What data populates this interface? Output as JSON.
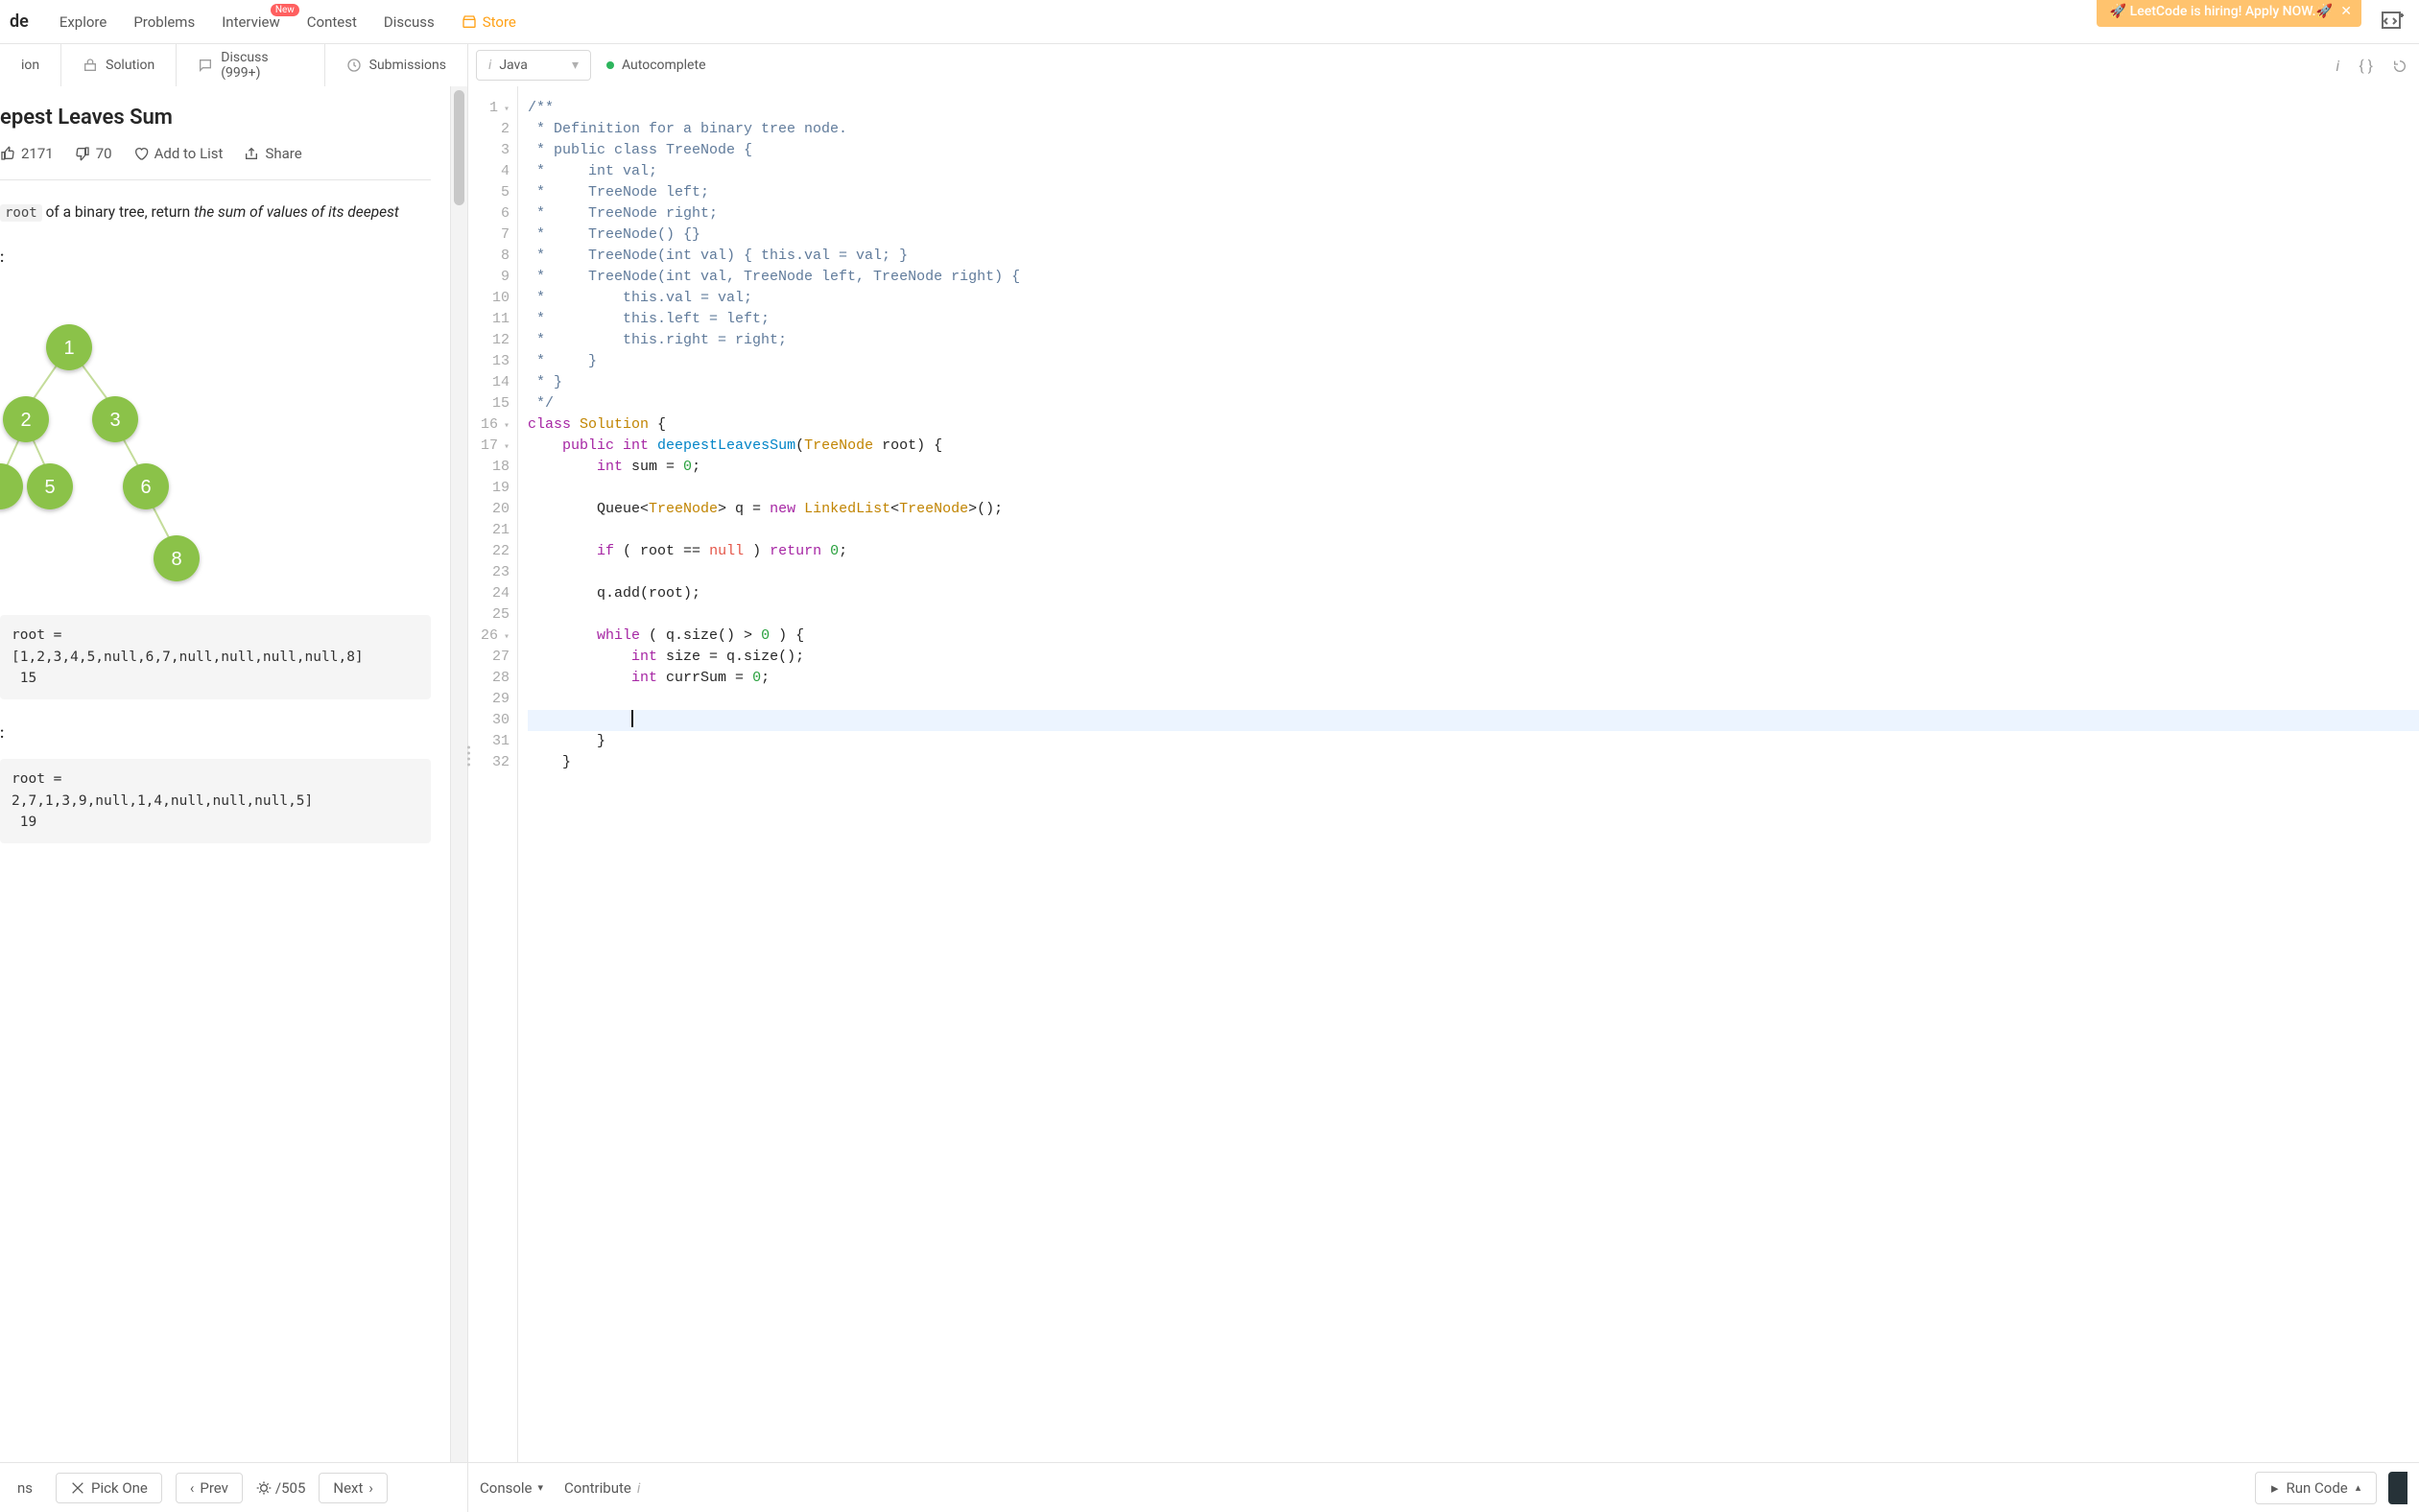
{
  "nav": {
    "brand_partial": "de",
    "links": [
      "Explore",
      "Problems",
      "Interview",
      "Contest",
      "Discuss",
      "Store"
    ],
    "interview_badge": "New",
    "hiring_text": "🚀 LeetCode is hiring! Apply NOW.🚀"
  },
  "left_tabs": {
    "description_partial": "ion",
    "solution": "Solution",
    "discuss": "Discuss (999+)",
    "submissions": "Submissions"
  },
  "editor_bar": {
    "language": "Java",
    "autocomplete": "Autocomplete"
  },
  "problem": {
    "title_partial": "epest Leaves Sum",
    "likes": "2171",
    "dislikes": "70",
    "add_to_list": "Add to List",
    "share": "Share",
    "body_prefix": "root",
    "body_mid": " of a binary tree, return ",
    "body_em": "the sum of values of its deepest",
    "example1_label": ":",
    "example1_block": "root = [1,2,3,4,5,null,6,7,null,null,null,null,8]\n 15",
    "example2_label": ":",
    "example2_block": "root =\n2,7,1,3,9,null,1,4,null,null,null,5]\n 19",
    "tree_nodes": {
      "n1": "1",
      "n2": "2",
      "n3": "3",
      "n5": "5",
      "n6": "6",
      "n8": "8"
    }
  },
  "code_lines": [
    {
      "n": 1,
      "fold": true,
      "segs": [
        {
          "t": "/**",
          "c": "comment"
        }
      ]
    },
    {
      "n": 2,
      "segs": [
        {
          "t": " * Definition for a binary tree node.",
          "c": "comment"
        }
      ]
    },
    {
      "n": 3,
      "segs": [
        {
          "t": " * public class TreeNode {",
          "c": "comment"
        }
      ]
    },
    {
      "n": 4,
      "segs": [
        {
          "t": " *     int val;",
          "c": "comment"
        }
      ]
    },
    {
      "n": 5,
      "segs": [
        {
          "t": " *     TreeNode left;",
          "c": "comment"
        }
      ]
    },
    {
      "n": 6,
      "segs": [
        {
          "t": " *     TreeNode right;",
          "c": "comment"
        }
      ]
    },
    {
      "n": 7,
      "segs": [
        {
          "t": " *     TreeNode() {}",
          "c": "comment"
        }
      ]
    },
    {
      "n": 8,
      "segs": [
        {
          "t": " *     TreeNode(int val) { this.val = val; }",
          "c": "comment"
        }
      ]
    },
    {
      "n": 9,
      "segs": [
        {
          "t": " *     TreeNode(int val, TreeNode left, TreeNode right) {",
          "c": "comment"
        }
      ]
    },
    {
      "n": 10,
      "segs": [
        {
          "t": " *         this.val = val;",
          "c": "comment"
        }
      ]
    },
    {
      "n": 11,
      "segs": [
        {
          "t": " *         this.left = left;",
          "c": "comment"
        }
      ]
    },
    {
      "n": 12,
      "segs": [
        {
          "t": " *         this.right = right;",
          "c": "comment"
        }
      ]
    },
    {
      "n": 13,
      "segs": [
        {
          "t": " *     }",
          "c": "comment"
        }
      ]
    },
    {
      "n": 14,
      "segs": [
        {
          "t": " * }",
          "c": "comment"
        }
      ]
    },
    {
      "n": 15,
      "segs": [
        {
          "t": " */",
          "c": "comment"
        }
      ]
    },
    {
      "n": 16,
      "fold": true,
      "segs": [
        {
          "t": "class ",
          "c": "kw"
        },
        {
          "t": "Solution",
          "c": "type"
        },
        {
          "t": " {",
          "c": ""
        }
      ]
    },
    {
      "n": 17,
      "fold": true,
      "segs": [
        {
          "t": "    ",
          "c": ""
        },
        {
          "t": "public ",
          "c": "kw"
        },
        {
          "t": "int ",
          "c": "kw"
        },
        {
          "t": "deepestLeavesSum",
          "c": "name"
        },
        {
          "t": "(",
          "c": ""
        },
        {
          "t": "TreeNode",
          "c": "type"
        },
        {
          "t": " root) {",
          "c": ""
        }
      ]
    },
    {
      "n": 18,
      "segs": [
        {
          "t": "        ",
          "c": ""
        },
        {
          "t": "int ",
          "c": "kw"
        },
        {
          "t": "sum = ",
          "c": ""
        },
        {
          "t": "0",
          "c": "num"
        },
        {
          "t": ";",
          "c": ""
        }
      ]
    },
    {
      "n": 19,
      "segs": [
        {
          "t": "",
          "c": ""
        }
      ]
    },
    {
      "n": 20,
      "segs": [
        {
          "t": "        Queue<",
          "c": ""
        },
        {
          "t": "TreeNode",
          "c": "type"
        },
        {
          "t": "> q = ",
          "c": ""
        },
        {
          "t": "new ",
          "c": "kw"
        },
        {
          "t": "LinkedList",
          "c": "type"
        },
        {
          "t": "<",
          "c": ""
        },
        {
          "t": "TreeNode",
          "c": "type"
        },
        {
          "t": ">();",
          "c": ""
        }
      ]
    },
    {
      "n": 21,
      "segs": [
        {
          "t": "",
          "c": ""
        }
      ]
    },
    {
      "n": 22,
      "segs": [
        {
          "t": "        ",
          "c": ""
        },
        {
          "t": "if",
          "c": "kw"
        },
        {
          "t": " ( root == ",
          "c": ""
        },
        {
          "t": "null",
          "c": "null"
        },
        {
          "t": " ) ",
          "c": ""
        },
        {
          "t": "return ",
          "c": "kw"
        },
        {
          "t": "0",
          "c": "num"
        },
        {
          "t": ";",
          "c": ""
        }
      ]
    },
    {
      "n": 23,
      "segs": [
        {
          "t": "",
          "c": ""
        }
      ]
    },
    {
      "n": 24,
      "segs": [
        {
          "t": "        q.add(root);",
          "c": ""
        }
      ]
    },
    {
      "n": 25,
      "segs": [
        {
          "t": "",
          "c": ""
        }
      ]
    },
    {
      "n": 26,
      "fold": true,
      "segs": [
        {
          "t": "        ",
          "c": ""
        },
        {
          "t": "while",
          "c": "kw"
        },
        {
          "t": " ( q.size() > ",
          "c": ""
        },
        {
          "t": "0",
          "c": "num"
        },
        {
          "t": " ) {",
          "c": ""
        }
      ]
    },
    {
      "n": 27,
      "segs": [
        {
          "t": "            ",
          "c": ""
        },
        {
          "t": "int ",
          "c": "kw"
        },
        {
          "t": "size = q.size();",
          "c": ""
        }
      ]
    },
    {
      "n": 28,
      "segs": [
        {
          "t": "            ",
          "c": ""
        },
        {
          "t": "int ",
          "c": "kw"
        },
        {
          "t": "currSum = ",
          "c": ""
        },
        {
          "t": "0",
          "c": "num"
        },
        {
          "t": ";",
          "c": ""
        }
      ]
    },
    {
      "n": 29,
      "segs": [
        {
          "t": "",
          "c": ""
        }
      ]
    },
    {
      "n": 30,
      "active": true,
      "cursor": true,
      "segs": [
        {
          "t": "            ",
          "c": ""
        }
      ]
    },
    {
      "n": 31,
      "segs": [
        {
          "t": "        }",
          "c": ""
        }
      ]
    },
    {
      "n": 32,
      "segs": [
        {
          "t": "    }",
          "c": ""
        }
      ]
    }
  ],
  "bottom": {
    "problems_partial": "ns",
    "pick_one": "Pick One",
    "prev": "Prev",
    "progress": "/505",
    "next": "Next",
    "console": "Console",
    "contribute": "Contribute",
    "run_code": "Run Code"
  }
}
